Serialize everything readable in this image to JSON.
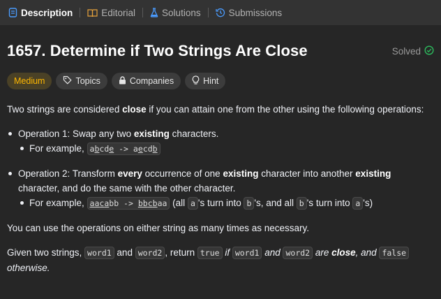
{
  "tabs": [
    {
      "label": "Description",
      "icon": "description-icon"
    },
    {
      "label": "Editorial",
      "icon": "book-icon"
    },
    {
      "label": "Solutions",
      "icon": "flask-icon"
    },
    {
      "label": "Submissions",
      "icon": "history-icon"
    }
  ],
  "problem": {
    "title": "1657. Determine if Two Strings Are Close",
    "status": "Solved",
    "difficulty": "Medium",
    "tag_topics": "Topics",
    "tag_companies": "Companies",
    "tag_hint": "Hint"
  },
  "colors": {
    "medium": "#ffb800",
    "solved_check": "#2cbb5d",
    "bg": "#262626",
    "tabbar": "#333333"
  },
  "desc": {
    "p1_a": "Two strings are considered ",
    "p1_b": "close",
    "p1_c": " if you can attain one from the other using the following operations:",
    "op1_a": "Operation 1: Swap any two ",
    "op1_b": "existing",
    "op1_c": " characters.",
    "op1_ex": "For example, ",
    "op1_code_pre": "a",
    "op1_code_b": "b",
    "op1_code_mid": "cd",
    "op1_code_e": "e",
    "op1_arrow": " -> ",
    "op1_code2_a": "a",
    "op1_code2_e": "e",
    "op1_code2_mid": "cd",
    "op1_code2_b": "b",
    "op2_a": "Operation 2: Transform ",
    "op2_b": "every",
    "op2_c": " occurrence of one ",
    "op2_d": "existing",
    "op2_e": " character into another ",
    "op2_f": "existing",
    "op2_g": " character, and do the same with the other character.",
    "op2_ex": "For example, ",
    "op2_code1_a": "aa",
    "op2_code1_c": "c",
    "op2_code1_a2": "a",
    "op2_code1_bb": "bb",
    "op2_arrow": " -> ",
    "op2_code2_bb": "bb",
    "op2_code2_c": "c",
    "op2_code2_b": "b",
    "op2_code2_aa": "aa",
    "op2_t1": " (all ",
    "op2_ca": "a",
    "op2_t2": "'s turn into ",
    "op2_cb": "b",
    "op2_t3": "'s, and all ",
    "op2_cb2": "b",
    "op2_t4": "'s turn into ",
    "op2_ca2": "a",
    "op2_t5": "'s)",
    "p3": "You can use the operations on either string as many times as necessary.",
    "p4_a": "Given two strings, ",
    "p4_w1": "word1",
    "p4_and": " and ",
    "p4_w2": "word2",
    "p4_ret": ", return ",
    "p4_true": "true",
    "p4_if": " if ",
    "p4_w1b": "word1",
    "p4_and2": " and ",
    "p4_w2b": "word2",
    "p4_are": " are ",
    "p4_close": "close",
    "p4_and3": ", and ",
    "p4_false": "false",
    "p4_other": "otherwise."
  }
}
